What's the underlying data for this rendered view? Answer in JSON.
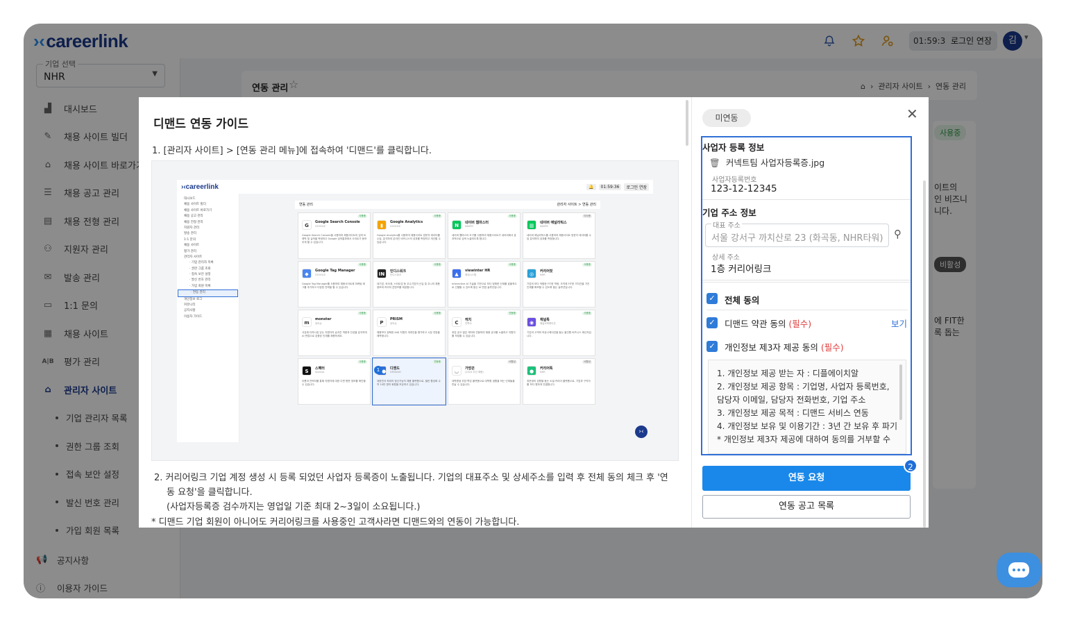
{
  "app": {
    "logo": "careerlink"
  },
  "topbar": {
    "timer": "01:59:36",
    "extend_label": "로그인 연장",
    "avatar": "김"
  },
  "company": {
    "label": "기업 선택",
    "value": "NHR"
  },
  "sidebar": {
    "items": [
      {
        "label": "대시보드",
        "icon": "dashboard-icon"
      },
      {
        "label": "채용 사이트 빌더",
        "icon": "builder-icon"
      },
      {
        "label": "채용 사이트 바로가기",
        "icon": "home-link-icon"
      },
      {
        "label": "채용 공고 관리",
        "icon": "list-icon"
      },
      {
        "label": "채용 전형 관리",
        "icon": "clipboard-icon"
      },
      {
        "label": "지원자 관리",
        "icon": "people-icon"
      },
      {
        "label": "발송 관리",
        "icon": "mail-icon"
      },
      {
        "label": "1:1 문의",
        "icon": "chat-icon"
      },
      {
        "label": "채용 사이트",
        "icon": "calendar-icon"
      },
      {
        "label": "평가 관리",
        "icon": "ab-icon"
      },
      {
        "label": "관리자 사이트",
        "icon": "admin-home-icon"
      }
    ],
    "sub_items": [
      "기업 관리자 목록",
      "권한 그룹 조회",
      "접속 보안 설정",
      "발신 번호 관리",
      "가입 회원 목록"
    ],
    "footer": [
      {
        "label": "공지사항",
        "icon": "megaphone-icon"
      },
      {
        "label": "이용자 가이드",
        "icon": "help-icon"
      }
    ]
  },
  "page": {
    "title": "연동 관리",
    "breadcrumb": [
      "관리자 사이트",
      "연동 관리"
    ]
  },
  "background": {
    "badge_active": "사용중",
    "badge_inactive": "비활성",
    "text1": "이트의\n인 비즈니\n니다.",
    "text2": "에 FIT한\n록 돕는"
  },
  "guide": {
    "title": "디맨드 연동 가이드",
    "step1": "1. [관리자 사이트] > [연동 관리 메뉴]에 접속하여 '디맨드'를 클릭합니다.",
    "step2_line1": "2. 커리어링크 기업 계정 생성 시 등록 되었던 사업자 등록증이 노출됩니다. 기업의 대표주소 및 상세주소를 입력 후 전체 동의 체크 후 '연",
    "step2_line2": "동 요청'을 클릭합니다.",
    "step2_line3": "(사업자등록증 검수까지는 영업일 기준 최대 2~3일이 소요됩니다.)",
    "note": "* 디맨드 기업 회원이 아니어도 커리어링크를 사용중인 고객사라면 디맨드와의 연동이 가능합니다."
  },
  "mini": {
    "logo": "careerlink",
    "timer": "01:59:36",
    "extend": "로그인 연장",
    "page_title": "연동 관리",
    "breadcrumb": "관리자 사이트  >  연동 관리",
    "nav": [
      "대시보드",
      "채용 사이트 빌더",
      "채용 사이트 바로가기",
      "채용 공고 관리",
      "채용 전형 관리",
      "지원자 관리",
      "발송 관리",
      "1:1 문의",
      "채용 사이트",
      "평가 관리",
      "관리자 사이트"
    ],
    "nav_sub": [
      "기업 관리자 목록",
      "권한 그룹 조회",
      "접속 보안 설정",
      "발신 번호 관리",
      "가입 회원 목록",
      "연동 관리"
    ],
    "nav_footer": [
      "개인정보 로그",
      "커뮤니티",
      "공지사항",
      "이용자 가이드"
    ],
    "cards": [
      {
        "name": "Google Search Console",
        "sub": "GOOGLE",
        "status": "사용중",
        "color": "#ffffff",
        "glyph": "G",
        "desc": "Google Search Console을 사용하여 채용사이트의 검색 트래픽 및 실적을 측정하고 Google 검색결과에서 사이트가 돋보이게 할 수 있습니다."
      },
      {
        "name": "Google Analytics",
        "sub": "GOOGLE",
        "status": "사용중",
        "color": "#f4a300",
        "glyph": "▮",
        "desc": "Google Analytics를 사용하여 채용사이트 방문자 데이터를 수집, 분석하여 온라인 비즈니스의 성과를 측정하고 개선할 수 있습니다."
      },
      {
        "name": "네이버 웹마스터",
        "sub": "NAVER",
        "status": "사용중",
        "color": "#03c75a",
        "glyph": "N",
        "desc": "네이버 웹마스터 도구를 사용하여 채용사이트가 네이버에서 효과적으로 검색 노출되도록 합니다."
      },
      {
        "name": "네이버 애널리틱스",
        "sub": "NAVER",
        "status": "미사용",
        "color": "#03c75a",
        "glyph": "▥",
        "desc": "네이버 애널리틱스를 사용하여 채용사이트 방문자 데이터를 수집 분석하여 성과를 측정합니다."
      },
      {
        "name": "Google Tag Manager",
        "sub": "GOOGLE",
        "status": "사용중",
        "color": "#4a86f0",
        "glyph": "◆",
        "desc": "Google Tag Manager를 사용하여 채용사이트에 마케팅 태그를 추가하고 다양한 전략을 할 수 있습니다."
      },
      {
        "name": "인디스워크",
        "sub": "인디스워크",
        "status": "사용중",
        "color": "#222222",
        "glyph": "IN",
        "desc": "대기업, 외국계, 스타트업 등 우수기업의 신입 및 주니어 채용 정보와 커리어 콘텐츠를 제공합니다."
      },
      {
        "name": "viewinter HR",
        "sub": "제네시스랩",
        "status": "사용중",
        "color": "#3a6ff0",
        "glyph": "▲",
        "desc": "Interactive AI 기술을 기반으로 보다 정확한 인재를 효율적으로 선별할 수 있도록 돕는 AI 면접 솔루션입니다."
      },
      {
        "name": "커리어핏",
        "sub": "NHR",
        "status": "사용중",
        "color": "#2aa0d8",
        "glyph": "◎",
        "desc": "기업의 보다 적합한 FIT한 역량, 조직에 FIT한 가치관을 가진 인재를 확보할 수 있도록 돕는 솔루션입니다."
      },
      {
        "name": "monster",
        "sub": "유어슈",
        "status": "사용중",
        "color": "#ffffff",
        "glyph": "m",
        "desc": "서강에 더하시킹 있는 지원자의 숨겨진 역량과 인성을 분석하여 AI 면접으로 검증된 인재를 채용하세요."
      },
      {
        "name": "PRISM",
        "sub": "유어슈",
        "status": "사용중",
        "color": "#ffffff",
        "glyph": "P",
        "desc": "채용보다 정확한 AI로 지원자 개개인을 평가하고 시장 전망을 예측합니다."
      },
      {
        "name": "캐치",
        "sub": "진학사",
        "status": "연동중",
        "color": "#ffffff",
        "glyph": "C",
        "desc": "취업 공고 많은 캐치와 연동하여 채용 공고를 노출하고 지원자를 모집할 수 있습니다."
      },
      {
        "name": "채널톡",
        "sub": "채널코퍼레이션",
        "status": "사용중",
        "color": "#6b4fe0",
        "glyph": "◉",
        "desc": "기업과 고객의 커뮤니케이션을 돕는 올인원 비즈니스 메신저입니다."
      },
      {
        "name": "스펙터",
        "sub": "Spector",
        "status": "사용중",
        "color": "#111111",
        "glyph": "S",
        "desc": "이름과 연락처를 통해 지원자에 대한 다면 평판 정보를 확인할 수 있습니다."
      },
      {
        "name": "디맨드",
        "sub": "DEMAND",
        "status": "연동중",
        "color": "#2f6fd6",
        "glyph": "●●",
        "desc": "대한민국 최대의 정신가능직 채용 플랫폼으로, 챌린 활성화 수 약 10만 명의 회원을 보유하고 있습니다."
      },
      {
        "name": "가방끈",
        "sub": "(2024 우선 채용)",
        "status": "비활성",
        "color": "#ffffff",
        "glyph": "◡",
        "desc": "대학원생 취업·학업 플랫폼으로 대학원 생활을 하는 인재들을 만날 수 있습니다."
      },
      {
        "name": "커리어톡",
        "sub": "NHR",
        "status": "비활성",
        "color": "#1ec07a",
        "glyph": "●",
        "desc": "취준생의 성향을 돕는 소셜 커리어 플랫폼으로, 기업과 구직자를 보다 원하게 연결합니다."
      }
    ]
  },
  "form": {
    "status_pill": "미연동",
    "biz_section": "사업자 등록 정보",
    "file_name": "커넥트팀 사업자등록증.jpg",
    "biz_no_label": "사업자등록번호",
    "biz_no": "123-12-12345",
    "addr_section": "기업 주소 정보",
    "main_addr_label": "대표 주소",
    "main_addr": "서울 강서구 까치산로 23 (화곡동, NHR타워)",
    "detail_addr_label": "상세 주소",
    "detail_addr": "1층 커리어링크",
    "agree_all": "전체 동의",
    "agree_terms": "디맨드 약관 동의 ",
    "agree_privacy": "개인정보 제3자 제공 동의 ",
    "required": "(필수)",
    "view": "보기",
    "terms_lines": [
      "1. 개인정보 제공 받는 자 : 디플에이치알",
      "2. 개인정보 제공 항목 : 기업명, 사업자 등록번호, 담당자 이메일, 담당자 전화번호, 기업 주소",
      "3. 개인정보 제공 목적 : 디맨드 서비스 연동",
      "4. 개인정보 보유 및 이용기간 : 3년 간 보유 후 파기",
      "* 개인정보 제3자 제공에 대하여 동의를 거부할 수"
    ],
    "submit": "연동 요청",
    "list_btn": "연동 공고 목록"
  },
  "badges": {
    "one": "1",
    "two": "2"
  },
  "colors": {
    "brand": "#1b3a8c",
    "accent": "#1a88ea",
    "required": "#e03b3b"
  }
}
